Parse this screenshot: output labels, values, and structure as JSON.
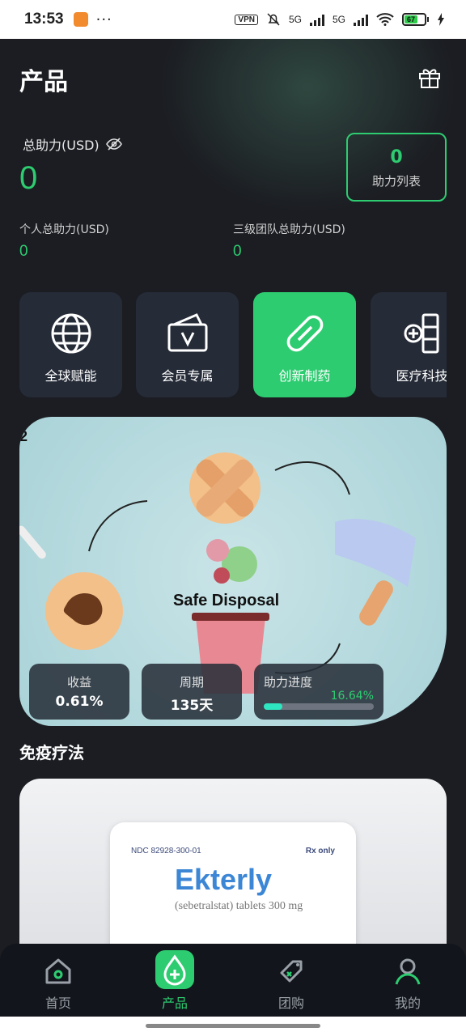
{
  "status_bar": {
    "time": "13:53",
    "dots": "···",
    "vpn": "VPN",
    "net1": "5G",
    "net2": "5G",
    "battery": "67"
  },
  "header": {
    "title": "产品"
  },
  "summary": {
    "total_label": "总助力(USD)",
    "total_value": "0",
    "list_count": "0",
    "list_label": "助力列表",
    "personal_label": "个人总助力(USD)",
    "personal_value": "0",
    "team_label": "三级团队总助力(USD)",
    "team_value": "0"
  },
  "categories": [
    {
      "label": "全球赋能",
      "icon": "globe-icon"
    },
    {
      "label": "会员专属",
      "icon": "vip-card-icon"
    },
    {
      "label": "创新制药",
      "icon": "pill-icon"
    },
    {
      "label": "医疗科技",
      "icon": "medical-tech-icon"
    }
  ],
  "banner": {
    "tag": "2",
    "headline": "Safe Disposal",
    "income_label": "收益",
    "income_value": "0.61%",
    "period_label": "周期",
    "period_value": "135天",
    "progress_label": "助力进度",
    "progress_value": "16.64%",
    "progress_fraction": 0.1664
  },
  "section": {
    "title": "免疫疗法"
  },
  "product": {
    "ndc": "NDC 82928-300-01",
    "rx": "Rx only",
    "brand": "Ekterly",
    "generic": "(sebetralstat) tablets 300 mg"
  },
  "tabs": [
    {
      "label": "首页",
      "icon": "home-icon"
    },
    {
      "label": "产品",
      "icon": "product-drop-icon"
    },
    {
      "label": "团购",
      "icon": "group-buy-tag-icon"
    },
    {
      "label": "我的",
      "icon": "profile-icon"
    }
  ],
  "colors": {
    "accent": "#2ecc71",
    "background": "#1b1d22",
    "card": "#252b37"
  }
}
